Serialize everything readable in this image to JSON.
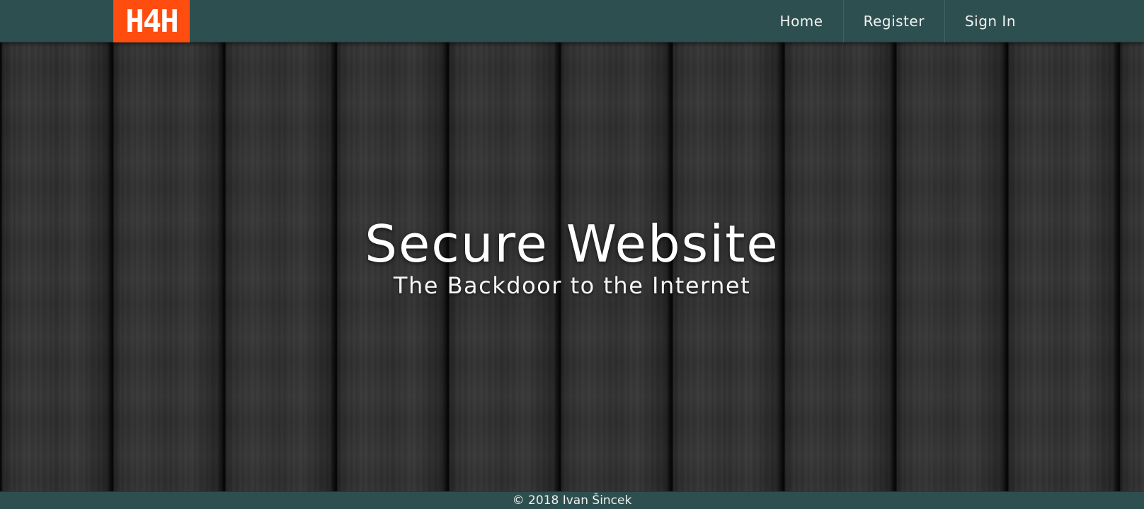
{
  "brand": {
    "logo_text": "H4H",
    "logo_color": "#ff4d0f"
  },
  "nav": {
    "items": [
      {
        "label": "Home"
      },
      {
        "label": "Register"
      },
      {
        "label": "Sign In"
      }
    ],
    "bar_color": "#2e4f4f"
  },
  "hero": {
    "title": "Secure Website",
    "subtitle": "The Backdoor to the Internet",
    "background": "dark wood planks"
  },
  "footer": {
    "text": "© 2018 Ivan Šincek"
  }
}
